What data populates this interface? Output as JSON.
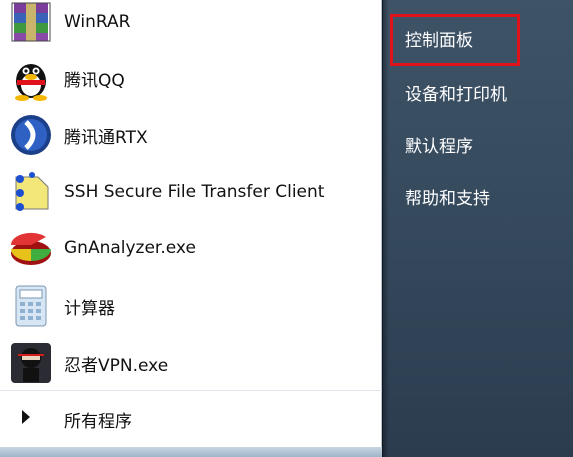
{
  "programs": [
    {
      "label": "WinRAR",
      "icon": "winrar-icon"
    },
    {
      "label": "腾讯QQ",
      "icon": "qq-penguin-icon"
    },
    {
      "label": "腾讯通RTX",
      "icon": "rtx-icon"
    },
    {
      "label": "SSH Secure File Transfer Client",
      "icon": "ssh-transfer-icon"
    },
    {
      "label": "GnAnalyzer.exe",
      "icon": "pie-chart-icon"
    },
    {
      "label": "计算器",
      "icon": "calculator-icon"
    },
    {
      "label": "忍者VPN.exe",
      "icon": "ninja-icon"
    }
  ],
  "all_programs": {
    "label": "所有程序",
    "icon": "triangle-right-icon"
  },
  "right_menu": [
    {
      "label": "控制面板"
    },
    {
      "label": "设备和打印机"
    },
    {
      "label": "默认程序"
    },
    {
      "label": "帮助和支持"
    }
  ],
  "highlight": {
    "target": "控制面板",
    "color": "#e0121b"
  }
}
